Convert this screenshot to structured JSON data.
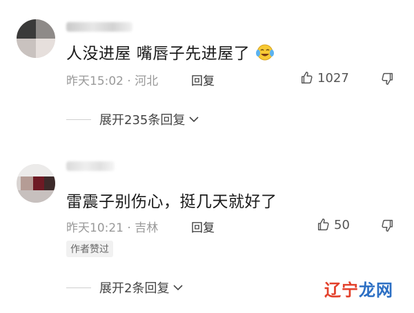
{
  "comments": [
    {
      "text": "人没进屋 嘴唇子先进屋了",
      "emoji_icon": "crying-laughing-emoji",
      "time_location": "昨天15:02 · 河北",
      "reply_label": "回复",
      "like_count": "1027",
      "expand_label": "展开235条回复"
    },
    {
      "text": "雷震子别伤心，挺几天就好了",
      "time_location": "昨天10:21 · 吉林",
      "reply_label": "回复",
      "like_count": "50",
      "badge": "作者赞过",
      "expand_label": "展开2条回复"
    }
  ],
  "watermark": {
    "part1": "辽宁",
    "part2": "龙网"
  },
  "colors": {
    "text": "#1a1a1a",
    "meta": "#999999",
    "watermark_red": "#e3402b",
    "watermark_blue": "#2c6fc4"
  }
}
